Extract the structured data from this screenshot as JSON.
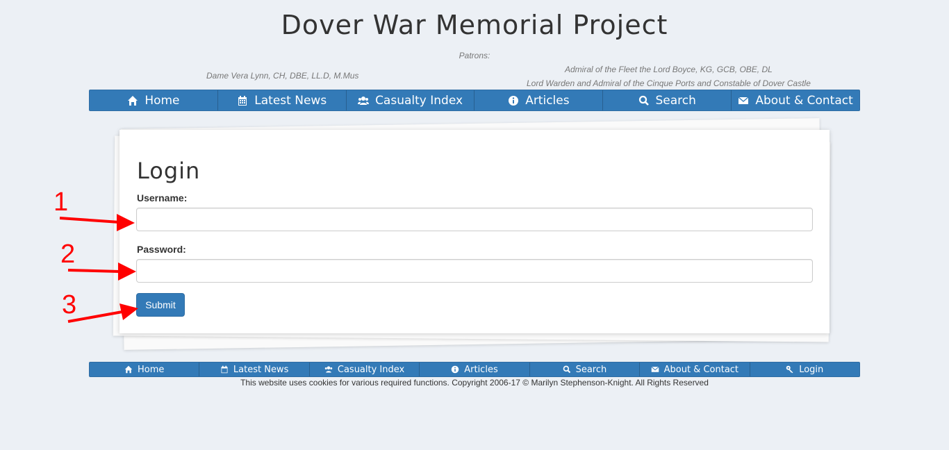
{
  "header": {
    "title": "Dover War Memorial Project",
    "patrons_label": "Patrons:",
    "patron_left": "Dame Vera Lynn, CH, DBE, LL.D, M.Mus",
    "patron_right_line1": "Admiral of the Fleet the Lord Boyce, KG, GCB, OBE, DL",
    "patron_right_line2": "Lord Warden and Admiral of the Cinque Ports and Constable of Dover Castle"
  },
  "nav": {
    "items": [
      {
        "label": "Home",
        "icon": "home-icon"
      },
      {
        "label": "Latest News",
        "icon": "calendar-icon"
      },
      {
        "label": "Casualty Index",
        "icon": "users-icon"
      },
      {
        "label": "Articles",
        "icon": "info-icon"
      },
      {
        "label": "Search",
        "icon": "search-icon"
      },
      {
        "label": "About & Contact",
        "icon": "envelope-icon"
      }
    ]
  },
  "login": {
    "title": "Login",
    "username_label": "Username:",
    "username_value": "",
    "password_label": "Password:",
    "password_value": "",
    "submit_label": "Submit"
  },
  "annotations": {
    "numbers": [
      "1",
      "2",
      "3"
    ],
    "color": "#ff0000"
  },
  "footer": {
    "items": [
      {
        "label": "Home",
        "icon": "home-icon"
      },
      {
        "label": "Latest News",
        "icon": "calendar-icon"
      },
      {
        "label": "Casualty Index",
        "icon": "users-icon"
      },
      {
        "label": "Articles",
        "icon": "info-icon"
      },
      {
        "label": "Search",
        "icon": "search-icon"
      },
      {
        "label": "About & Contact",
        "icon": "envelope-icon"
      },
      {
        "label": "Login",
        "icon": "key-icon"
      }
    ],
    "copyright": "This website uses cookies for various required functions. Copyright 2006-17 © Marilyn Stephenson-Knight. All Rights Reserved"
  },
  "colors": {
    "background": "#ecf0f5",
    "primary": "#337ab7",
    "annotation": "#ff0000"
  }
}
